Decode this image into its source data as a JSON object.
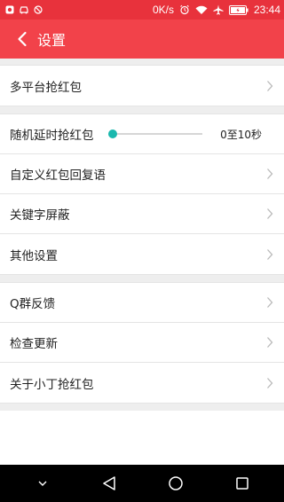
{
  "status_bar": {
    "net_speed": "0K/s",
    "time": "23:44",
    "icons": [
      "app-notification-icon",
      "car-icon",
      "blocked-icon",
      "alarm-icon",
      "wifi-icon",
      "airplane-mode-icon",
      "battery-icon"
    ],
    "color": "#e8323c"
  },
  "app_bar": {
    "title": "设置",
    "back_icon": "chevron-left-icon",
    "color": "#f2424a"
  },
  "sections": [
    {
      "items": [
        {
          "label": "多平台抢红包",
          "type": "nav"
        }
      ]
    },
    {
      "items": [
        {
          "label": "随机延时抢红包",
          "type": "slider",
          "value_text": "0至10秒",
          "slider_value": 0
        },
        {
          "label": "自定义红包回复语",
          "type": "nav"
        },
        {
          "label": "关键字屏蔽",
          "type": "nav"
        },
        {
          "label": "其他设置",
          "type": "nav"
        }
      ]
    },
    {
      "items": [
        {
          "label": "Q群反馈",
          "type": "nav"
        },
        {
          "label": "检查更新",
          "type": "nav"
        },
        {
          "label": "关于小丁抢红包",
          "type": "nav"
        }
      ]
    }
  ],
  "colors": {
    "accent": "#1ab8ae",
    "divider": "#e4e4e4",
    "section_gap": "#eeeeee"
  },
  "nav_bar": {
    "buttons": [
      "collapse-icon",
      "back-triangle-icon",
      "home-circle-icon",
      "recents-square-icon"
    ]
  }
}
